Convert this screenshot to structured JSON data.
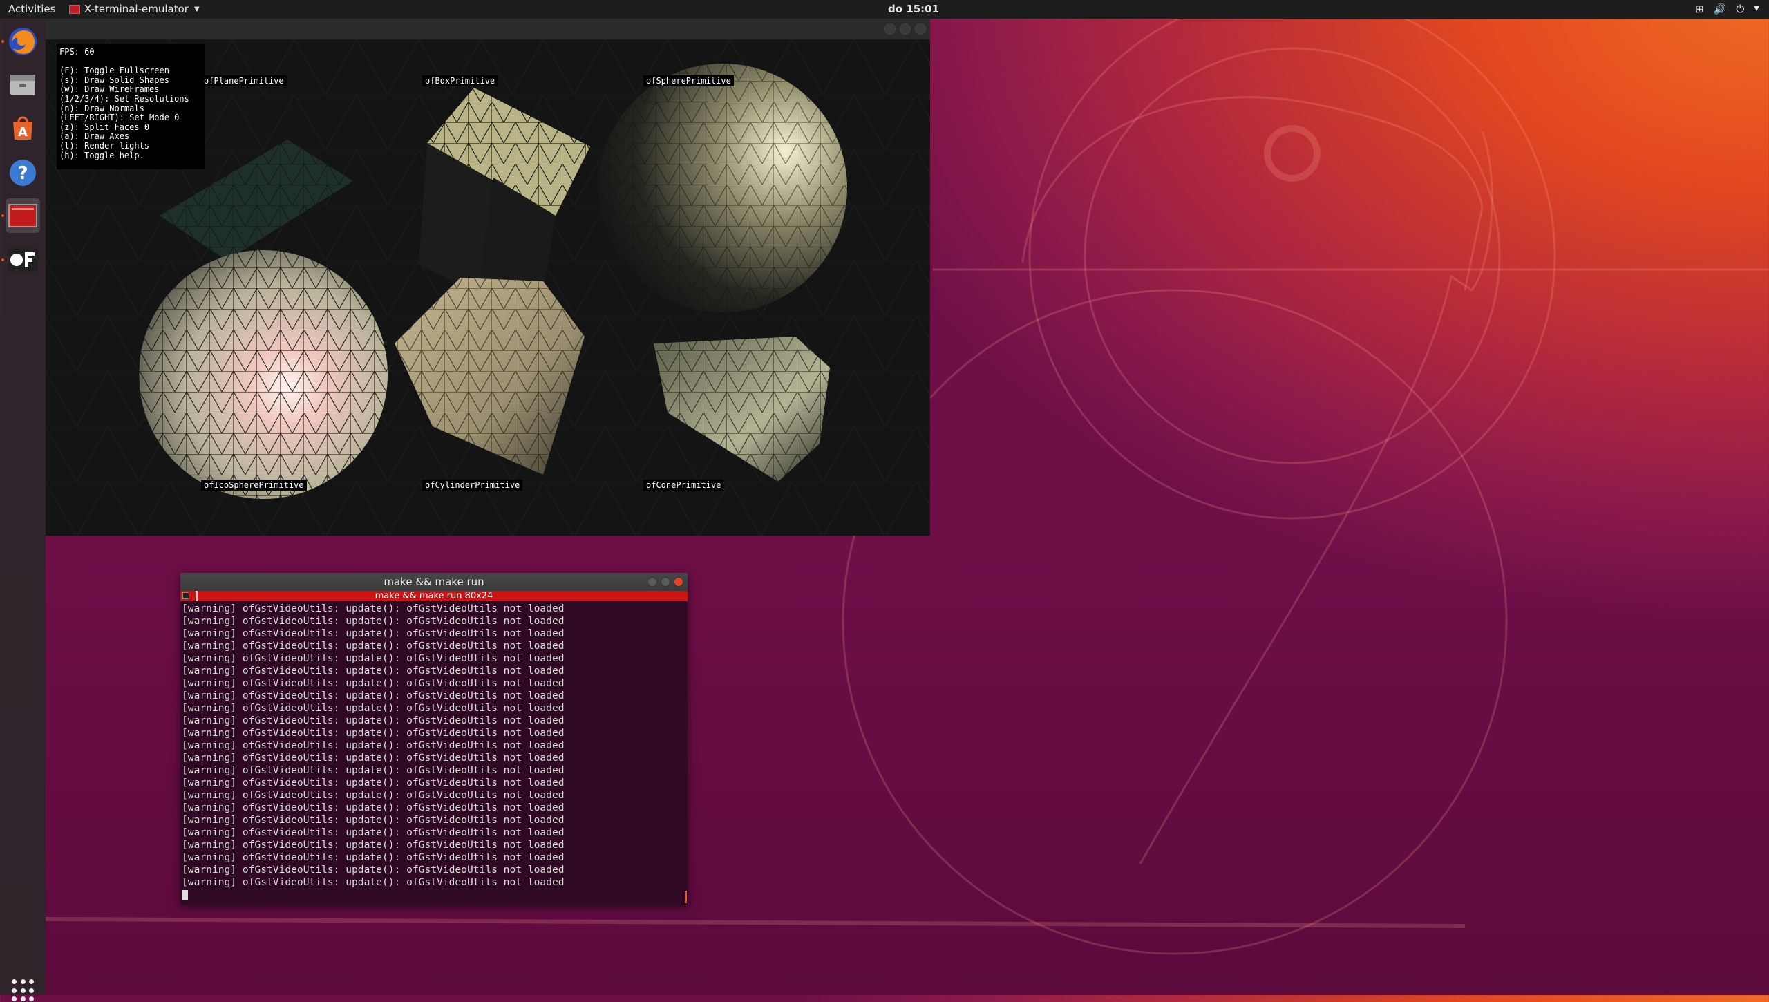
{
  "topbar": {
    "activities": "Activities",
    "app_name": "X-terminal-emulator",
    "clock": "do 15:01"
  },
  "dock": {
    "items": [
      "firefox-icon",
      "files-icon",
      "software-icon",
      "help-icon",
      "terminal-icon",
      "openframeworks-icon"
    ]
  },
  "of_window": {
    "help_lines": [
      "FPS: 60",
      "",
      "(F): Toggle Fullscreen",
      "(s): Draw Solid Shapes",
      "(w): Draw WireFrames",
      "(1/2/3/4): Set Resolutions",
      "(n): Draw Normals",
      "(LEFT/RIGHT): Set Mode 0",
      "(z): Split Faces 0",
      "(a): Draw Axes",
      "(l): Render lights",
      "(h): Toggle help."
    ],
    "labels": {
      "plane": "ofPlanePrimitive",
      "box": "ofBoxPrimitive",
      "sphere": "ofSpherePrimitive",
      "icosphere": "ofIcoSpherePrimitive",
      "cylinder": "ofCylinderPrimitive",
      "cone": "ofConePrimitive"
    }
  },
  "terminal": {
    "title": "make && make run",
    "tab_title": "make && make run 80x24",
    "lines": [
      "[warning] ofGstVideoUtils: update(): ofGstVideoUtils not loaded",
      "[warning] ofGstVideoUtils: update(): ofGstVideoUtils not loaded",
      "[warning] ofGstVideoUtils: update(): ofGstVideoUtils not loaded",
      "[warning] ofGstVideoUtils: update(): ofGstVideoUtils not loaded",
      "[warning] ofGstVideoUtils: update(): ofGstVideoUtils not loaded",
      "[warning] ofGstVideoUtils: update(): ofGstVideoUtils not loaded",
      "[warning] ofGstVideoUtils: update(): ofGstVideoUtils not loaded",
      "[warning] ofGstVideoUtils: update(): ofGstVideoUtils not loaded",
      "[warning] ofGstVideoUtils: update(): ofGstVideoUtils not loaded",
      "[warning] ofGstVideoUtils: update(): ofGstVideoUtils not loaded",
      "[warning] ofGstVideoUtils: update(): ofGstVideoUtils not loaded",
      "[warning] ofGstVideoUtils: update(): ofGstVideoUtils not loaded",
      "[warning] ofGstVideoUtils: update(): ofGstVideoUtils not loaded",
      "[warning] ofGstVideoUtils: update(): ofGstVideoUtils not loaded",
      "[warning] ofGstVideoUtils: update(): ofGstVideoUtils not loaded",
      "[warning] ofGstVideoUtils: update(): ofGstVideoUtils not loaded",
      "[warning] ofGstVideoUtils: update(): ofGstVideoUtils not loaded",
      "[warning] ofGstVideoUtils: update(): ofGstVideoUtils not loaded",
      "[warning] ofGstVideoUtils: update(): ofGstVideoUtils not loaded",
      "[warning] ofGstVideoUtils: update(): ofGstVideoUtils not loaded",
      "[warning] ofGstVideoUtils: update(): ofGstVideoUtils not loaded",
      "[warning] ofGstVideoUtils: update(): ofGstVideoUtils not loaded",
      "[warning] ofGstVideoUtils: update(): ofGstVideoUtils not loaded"
    ]
  }
}
